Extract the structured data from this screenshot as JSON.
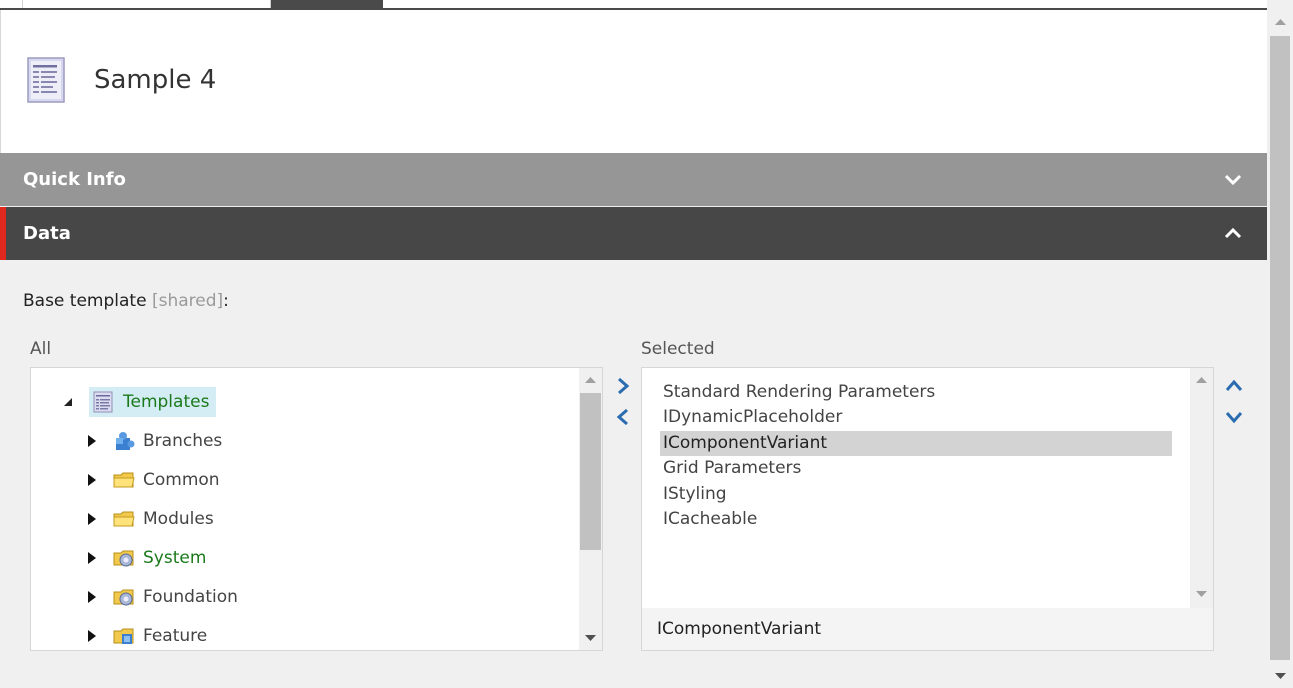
{
  "item": {
    "title": "Sample 4"
  },
  "sections": {
    "quick_info": "Quick Info",
    "data": "Data"
  },
  "field": {
    "label": "Base template",
    "shared": "[shared]",
    "colon": ":"
  },
  "tree": {
    "header": "All",
    "root": {
      "label": "Templates",
      "icon": "template-icon"
    },
    "children": [
      {
        "label": "Branches",
        "icon": "branch-puzzle-icon"
      },
      {
        "label": "Common",
        "icon": "folder-icon"
      },
      {
        "label": "Modules",
        "icon": "folder-icon"
      },
      {
        "label": "System",
        "icon": "system-folder-icon"
      },
      {
        "label": "Foundation",
        "icon": "system-folder-icon"
      },
      {
        "label": "Feature",
        "icon": "feature-folder-icon"
      }
    ]
  },
  "selected": {
    "header": "Selected",
    "items": [
      "Standard Rendering Parameters",
      "IDynamicPlaceholder",
      "IComponentVariant",
      "Grid Parameters",
      "IStyling",
      "ICacheable"
    ],
    "active_index": 2,
    "footer": "IComponentVariant"
  },
  "colors": {
    "accent_red": "#e0281e",
    "blue_arrow": "#2b6cb0",
    "green_text": "#1a7a1a"
  }
}
